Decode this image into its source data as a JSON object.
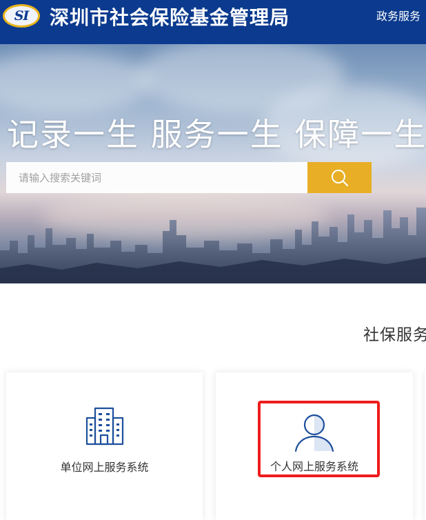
{
  "header": {
    "logo_text": "SI",
    "title": "深圳市社会保险基金管理局",
    "nav_item": "政务服务"
  },
  "banner": {
    "slogan": "记录一生 服务一生 保障一生",
    "search": {
      "placeholder": "请输入搜索关键词",
      "icon": "search-icon"
    }
  },
  "services": {
    "section_title": "社保服务",
    "cards": [
      {
        "label": "单位网上服务系统",
        "icon": "building-icon"
      },
      {
        "label": "个人网上服务系统",
        "icon": "person-icon"
      }
    ]
  },
  "colors": {
    "header_bg": "#0b3a8e",
    "logo_ring": "#e9b51d",
    "search_button": "#e8ae25",
    "icon_blue": "#1c4f9c",
    "highlight": "#ee1c1c"
  }
}
